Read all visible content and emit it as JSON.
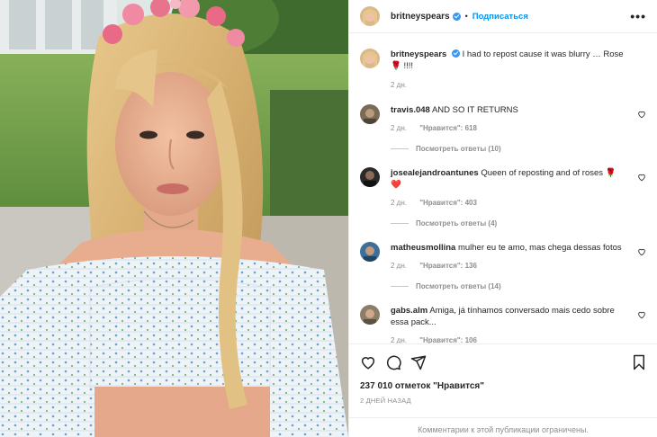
{
  "post": {
    "author": "britneyspears",
    "follow_label": "Подписаться",
    "dot": "•",
    "more": "•••",
    "caption": {
      "username": "britneyspears",
      "text": "I had to repost cause it was blurry … Rose 🌹 !!!!",
      "time": "2 дн."
    }
  },
  "comments": [
    {
      "username": "travis.048",
      "text": "AND SO IT RETURNS",
      "time": "2 дн.",
      "likes": "\"Нравится\": 618",
      "replies": "Посмотреть ответы (10)",
      "avatar_color": "#7b6a55"
    },
    {
      "username": "josealejandroantunes",
      "text": "Queen of reposting and of roses 🌹❤️",
      "time": "2 дн.",
      "likes": "\"Нравится\": 403",
      "replies": "Посмотреть ответы (4)",
      "avatar_color": "#2a2a2a"
    },
    {
      "username": "matheusmollina",
      "text": "mulher eu te amo, mas chega dessas fotos",
      "time": "2 дн.",
      "likes": "\"Нравится\": 136",
      "replies": "Посмотреть ответы (14)",
      "avatar_color": "#3c6f9a"
    },
    {
      "username": "gabs.alm",
      "text": "Amiga, já tínhamos conversado mais cedo sobre essa pack...",
      "time": "2 дн.",
      "likes": "\"Нравится\": 106",
      "replies": "",
      "avatar_color": "#8c7d6a"
    }
  ],
  "footer": {
    "likes_count": "237 010 отметок \"Нравится\"",
    "date": "2 ДНЕЙ НАЗАД",
    "comments_limited": "Комментарии к этой публикации ограничены."
  },
  "icons": {
    "like": "heart-icon",
    "comment": "comment-icon",
    "share": "share-icon",
    "save": "bookmark-icon",
    "verified": "verified-badge-icon"
  },
  "colors": {
    "accent": "#0095f6",
    "verified": "#3897f0",
    "muted": "#8e8e8e"
  }
}
